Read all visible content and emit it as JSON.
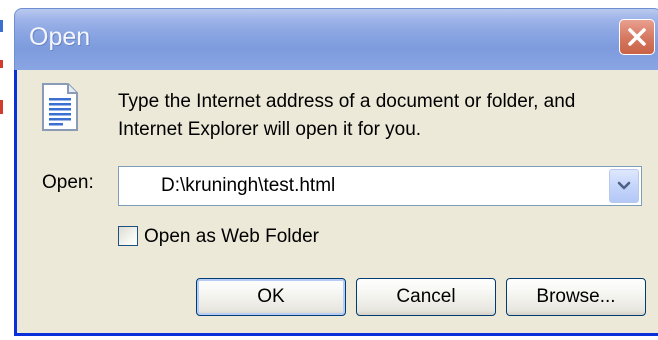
{
  "dialog": {
    "title": "Open",
    "message": "Type the Internet address of a document or folder, and Internet Explorer will open it for you.",
    "open_label": "Open:",
    "address_value": "D:\\kruningh\\test.html",
    "checkbox_label": "Open as Web Folder",
    "checkbox_checked": false,
    "buttons": {
      "ok": "OK",
      "cancel": "Cancel",
      "browse": "Browse..."
    }
  },
  "icons": {
    "close": "close-icon",
    "document": "document-icon",
    "dropdown": "chevron-down-icon"
  },
  "colors": {
    "title_bar": "#8aa5e2",
    "close_button": "#d67a63",
    "dialog_background": "#ece9d8",
    "frame_border": "#0831d9"
  }
}
